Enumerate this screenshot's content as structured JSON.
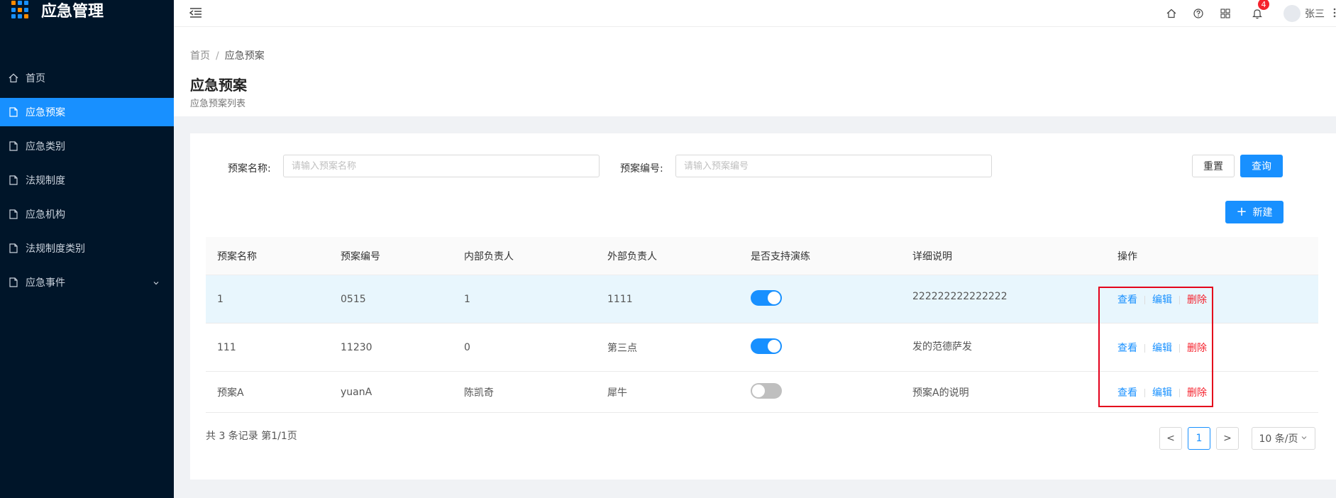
{
  "app": {
    "title": "应急管理"
  },
  "sidebar": {
    "items": [
      {
        "label": "首页",
        "icon": "home-icon",
        "active": false
      },
      {
        "label": "应急预案",
        "icon": "document-icon",
        "active": true
      },
      {
        "label": "应急类别",
        "icon": "document-icon",
        "active": false
      },
      {
        "label": "法规制度",
        "icon": "document-icon",
        "active": false
      },
      {
        "label": "应急机构",
        "icon": "document-icon",
        "active": false
      },
      {
        "label": "法规制度类别",
        "icon": "document-icon",
        "active": false
      },
      {
        "label": "应急事件",
        "icon": "document-icon",
        "active": false,
        "has_children": true
      }
    ]
  },
  "header": {
    "notification_count": "4",
    "user_name": "张三"
  },
  "breadcrumb": {
    "home": "首页",
    "separator": "/",
    "current": "应急预案"
  },
  "page": {
    "title": "应急预案",
    "subtitle": "应急预案列表"
  },
  "search": {
    "name_label": "预案名称:",
    "name_placeholder": "请输入预案名称",
    "code_label": "预案编号:",
    "code_placeholder": "请输入预案编号",
    "reset_label": "重置",
    "query_label": "查询",
    "new_label": "新建"
  },
  "table": {
    "columns": [
      "预案名称",
      "预案编号",
      "内部负责人",
      "外部负责人",
      "是否支持演练",
      "详细说明",
      "操作"
    ],
    "rows": [
      {
        "name": "1",
        "code": "0515",
        "internal": "1",
        "external": "1111",
        "drill": true,
        "desc": "222222222222222"
      },
      {
        "name": "111",
        "code": "11230",
        "internal": "0",
        "external": "第三点",
        "drill": true,
        "desc": "发的范德萨发"
      },
      {
        "name": "预案A",
        "code": "yuanA",
        "internal": "陈凯奇",
        "external": "犀牛",
        "drill": false,
        "desc": "预案A的说明"
      }
    ],
    "actions": {
      "view": "查看",
      "edit": "编辑",
      "delete": "删除"
    }
  },
  "pagination": {
    "summary": "共 3 条记录 第1/1页",
    "prev": "<",
    "current_page": "1",
    "next": ">",
    "page_size": "10 条/页"
  },
  "colors": {
    "primary": "#1890ff",
    "sidebar_bg": "#001529",
    "danger": "#f5222d",
    "highlight_box": "#e4001b"
  }
}
